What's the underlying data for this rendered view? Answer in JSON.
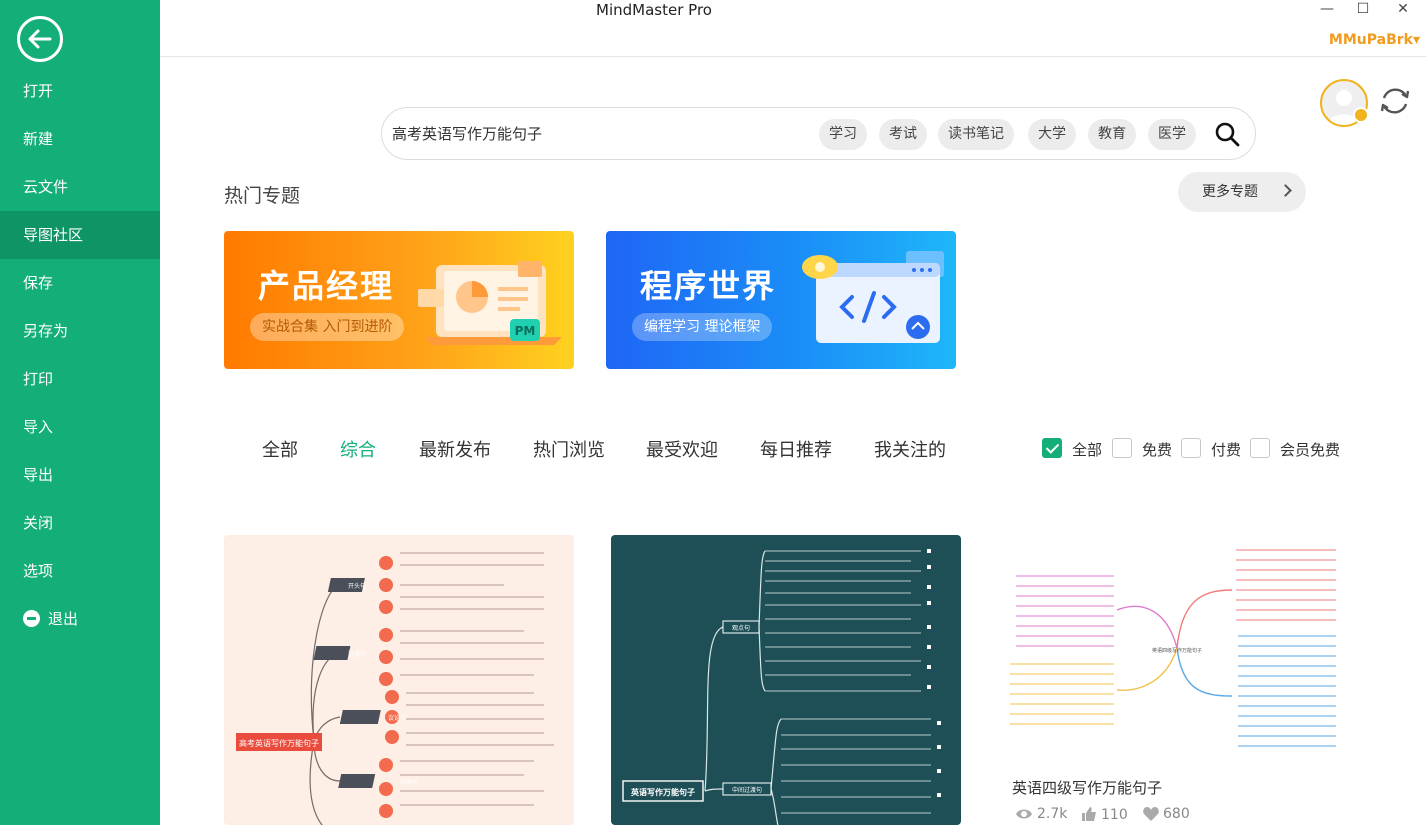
{
  "window": {
    "title": "MindMaster Pro",
    "controls": [
      "—",
      "☐",
      "✕"
    ],
    "user": "MMuPaBrk▾"
  },
  "sidebar": {
    "items": [
      {
        "label": "打开"
      },
      {
        "label": "新建"
      },
      {
        "label": "云文件"
      },
      {
        "label": "导图社区",
        "active": true
      },
      {
        "label": "保存"
      },
      {
        "label": "另存为"
      },
      {
        "label": "打印"
      },
      {
        "label": "导入"
      },
      {
        "label": "导出"
      },
      {
        "label": "关闭"
      },
      {
        "label": "选项"
      },
      {
        "label": "退出"
      }
    ]
  },
  "search": {
    "placeholder": "高考英语写作万能句子",
    "tags": [
      "学习",
      "考试",
      "读书笔记",
      "大学",
      "教育",
      "医学"
    ]
  },
  "hot": {
    "title": "热门专题",
    "more": "更多专题",
    "banners": [
      {
        "title": "产品经理",
        "subtitle": "实战合集 入门到进阶",
        "badge": "PM"
      },
      {
        "title": "程序世界",
        "subtitle": "编程学习 理论框架"
      }
    ]
  },
  "tabs": [
    "全部",
    "综合",
    "最新发布",
    "热门浏览",
    "最受欢迎",
    "每日推荐",
    "我关注的"
  ],
  "active_tab": "综合",
  "filters": [
    {
      "label": "全部",
      "checked": true
    },
    {
      "label": "免费",
      "checked": false
    },
    {
      "label": "付费",
      "checked": false
    },
    {
      "label": "会员免费",
      "checked": false
    }
  ],
  "cards": [
    {
      "root": "高考英语写作万能句子",
      "branches": [
        "开头句",
        "过渡句",
        "议论句",
        "结尾句"
      ]
    },
    {
      "root": "英语写作万能句子",
      "branches": [
        "观点句",
        "中间过渡句"
      ]
    },
    {
      "title": "英语四级写作万能句子",
      "root": "英语四级写作万能句子",
      "views": "2.7k",
      "likes": "110",
      "favorites": "680"
    }
  ],
  "colors": {
    "accent": "#14ae78",
    "user": "#f29c1f"
  }
}
